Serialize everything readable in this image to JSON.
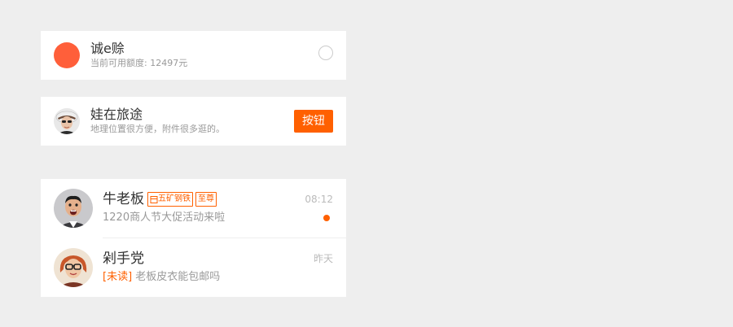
{
  "colors": {
    "accent": "#ff6000",
    "avatar_dot": "#ff5f3a",
    "page_bg": "#eeeeee"
  },
  "card_credit": {
    "title": "诚e赊",
    "subtitle": "当前可用额度: 12497元"
  },
  "card_travel": {
    "title": "娃在旅途",
    "subtitle": "地理位置很方便，附件很多逛的。",
    "button_label": "按钮"
  },
  "messages": [
    {
      "name": "牛老板",
      "badges": [
        {
          "icon": "shop-icon",
          "label": "五矿钢铁"
        },
        {
          "label": "至尊"
        }
      ],
      "time": "08:12",
      "preview": "1220商人节大促活动来啦",
      "has_new": true
    },
    {
      "name": "剁手党",
      "time": "昨天",
      "unread_tag": "[未读]",
      "preview": "老板皮衣能包邮吗"
    }
  ]
}
